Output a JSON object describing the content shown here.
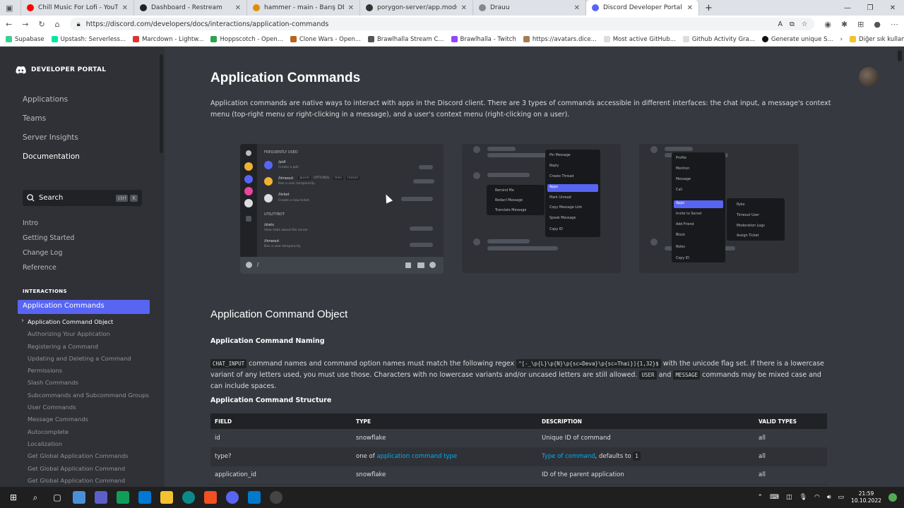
{
  "browser": {
    "tabs": [
      {
        "label": "Chill Music For Lofi - YouTube",
        "color": "#ff0000",
        "active": false
      },
      {
        "label": "Dashboard - Restream",
        "color": "#222222",
        "active": false
      },
      {
        "label": "hammer - main - Barış DEMİRCİ",
        "color": "#e38c00",
        "active": false
      },
      {
        "label": "porygon-server/app.module.ts at",
        "color": "#333333",
        "active": false
      },
      {
        "label": "Drauu",
        "color": "#888888",
        "active": false
      },
      {
        "label": "Discord Developer Portal — Doc",
        "color": "#5865f2",
        "active": true
      }
    ],
    "url": "https://discord.com/developers/docs/interactions/application-commands",
    "bookmarks": [
      "Supabase",
      "Upstash: Serverless...",
      "Marcdown - Lightw...",
      "Hoppscotch - Open...",
      "Clone Wars - Open...",
      "Brawlhalla Stream C...",
      "Brawlhalla - Twitch",
      "https://avatars.dice...",
      "Most active GitHub...",
      "Github Activity Gra...",
      "Generate unique S..."
    ],
    "bookmarks_other": "Diğer sık kullanılanlar"
  },
  "sidebar": {
    "brand": "DEVELOPER PORTAL",
    "top_items": [
      "Applications",
      "Teams",
      "Server Insights",
      "Documentation"
    ],
    "search": {
      "label": "Search",
      "keys": [
        "ctrl",
        "K"
      ]
    },
    "mid_items": [
      "Intro",
      "Getting Started",
      "Change Log",
      "Reference"
    ],
    "section": "INTERACTIONS",
    "active": "Application Commands",
    "sub_items": [
      "Application Command Object",
      "Authorizing Your Application",
      "Registering a Command",
      "Updating and Deleting a Command",
      "Permissions",
      "Slash Commands",
      "Subcommands and Subcommand Groups",
      "User Commands",
      "Message Commands",
      "Autocomplete",
      "Localization",
      "Get Global Application Commands",
      "Get Global Application Command",
      "Get Global Application Command"
    ]
  },
  "main": {
    "title": "Application Commands",
    "intro": "Application commands are native ways to interact with apps in the Discord client. There are 3 types of commands accessible in different interfaces: the chat input, a message's context menu (top-right menu or right-clicking in a message), and a user's context menu (right-clicking on a user).",
    "shot1": {
      "header": "FREQUENTLY USED",
      "cmds": [
        {
          "name": "/poll",
          "desc": "Create a poll"
        },
        {
          "name": "/timeout",
          "desc": "Ban a user temporarily"
        },
        {
          "name": "/ticket",
          "desc": "Create a new ticket"
        }
      ],
      "opts": [
        "@user",
        "OPTIONAL",
        "time",
        "reason"
      ],
      "header2": "UTILITYBOT",
      "cmds2": [
        {
          "name": "/stats",
          "desc": "View stats about the server"
        },
        {
          "name": "/timeout",
          "desc": "Ban a user temporarily"
        }
      ],
      "input": "/"
    },
    "shot2": {
      "menu": [
        "Pin Message",
        "Reply",
        "Create Thread",
        "Apps",
        "Mark Unread",
        "Copy Message Link",
        "Speak Message",
        "Copy ID"
      ],
      "sub": [
        "Remind Me",
        "Redact Message",
        "Translate Message"
      ]
    },
    "shot3": {
      "menu": [
        "Profile",
        "Mention",
        "Message",
        "Call",
        "Apps",
        "Invite to Server",
        "Add Friend",
        "Block",
        "Roles",
        "Copy ID"
      ],
      "sub": [
        "Ryko",
        "Timeout User",
        "Moderation Logs",
        "Assign Ticket"
      ]
    },
    "h2": "Application Command Object",
    "naming_title": "Application Command Naming",
    "naming": {
      "code1": "CHAT_INPUT",
      "t1": " command names and command option names must match the following regex ",
      "code2": "^[-_\\p{L}\\p{N}\\p{sc=Deva}\\p{sc=Thai}]{1,32}$",
      "t2": " with the unicode flag set. If there is a lowercase variant of any letters used, you must use those. Characters with no lowercase variants and/or uncased letters are still allowed. ",
      "code3": "USER",
      "t3": " and ",
      "code4": "MESSAGE",
      "t4": " commands may be mixed case and can include spaces."
    },
    "structure_title": "Application Command Structure",
    "table": {
      "headers": [
        "FIELD",
        "TYPE",
        "DESCRIPTION",
        "VALID TYPES"
      ],
      "rows": [
        {
          "field": "id",
          "type": "snowflake",
          "type_link": "",
          "desc": "Unique ID of command",
          "desc_link": "",
          "desc_code": "",
          "valid": "all"
        },
        {
          "field": "type?",
          "type": "one of ",
          "type_link": "application command type",
          "desc": ", defaults to ",
          "desc_link": "Type of command",
          "desc_code": "1",
          "valid": "all"
        },
        {
          "field": "application_id",
          "type": "snowflake",
          "type_link": "",
          "desc": "ID of the parent application",
          "desc_link": "",
          "desc_code": "",
          "valid": "all"
        }
      ]
    }
  },
  "taskbar": {
    "time": "21:59",
    "date": "10.10.2022"
  }
}
